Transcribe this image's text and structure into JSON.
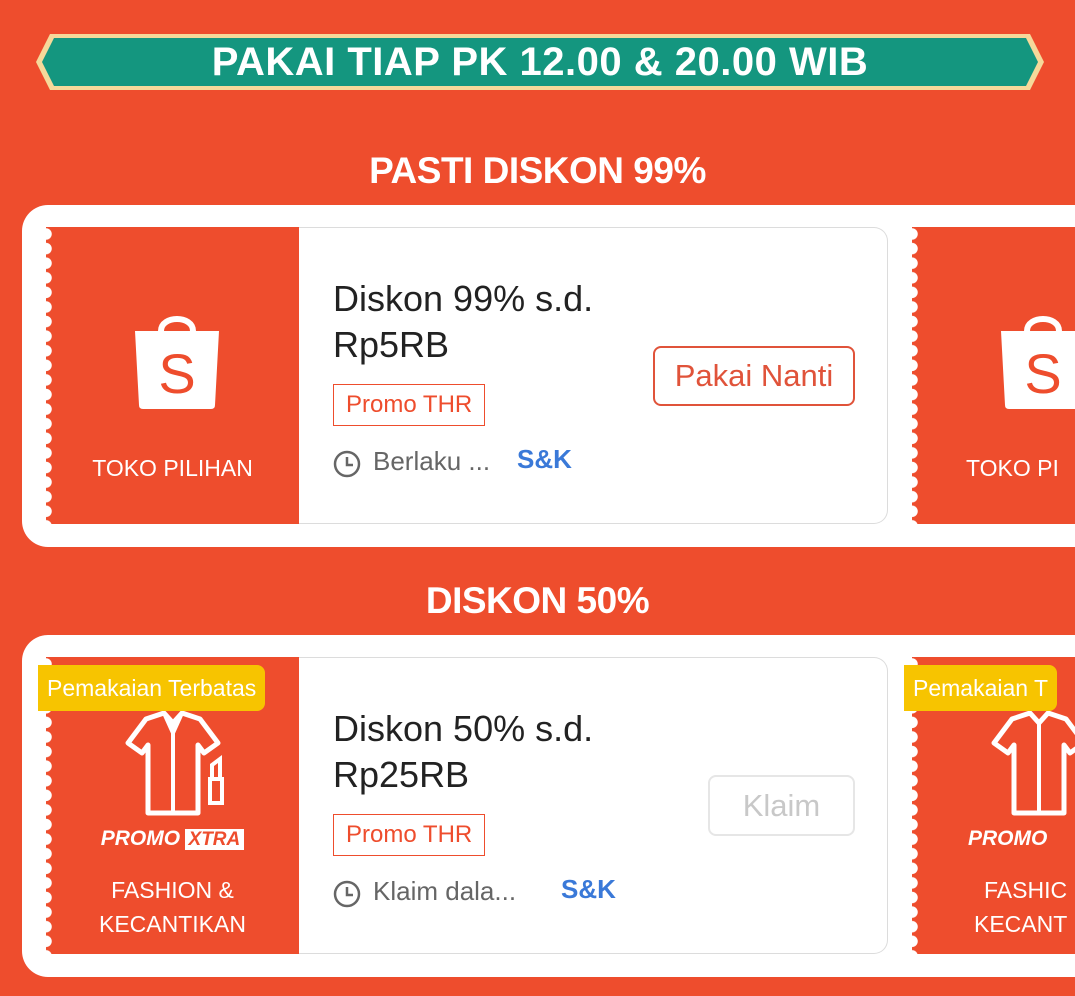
{
  "banner": {
    "text": "PAKAI TIAP PK 12.00 & 20.00 WIB",
    "bg_color": "#14967f",
    "border_color": "#f6d99a"
  },
  "sections": [
    {
      "title": "PASTI DISKON 99%",
      "voucher": {
        "category": "TOKO PILIHAN",
        "icon": "shopee-bag-icon",
        "title_line1": "Diskon 99% s.d.",
        "title_line2": "Rp5RB",
        "tag": "Promo THR",
        "validity": "Berlaku ...",
        "terms": "S&K",
        "button": "Pakai Nanti"
      },
      "next_voucher": {
        "category": "TOKO PI"
      }
    },
    {
      "title": "DISKON 50%",
      "voucher": {
        "badge": "Pemakaian Terbatas",
        "icon": "fashion-icon",
        "promo_logo_left": "PROMO",
        "promo_logo_right": "XTRA",
        "category_line1": "FASHION &",
        "category_line2": "KECANTIKAN",
        "title_line1": "Diskon 50% s.d.",
        "title_line2": "Rp25RB",
        "tag": "Promo THR",
        "validity": "Klaim dala...",
        "terms": "S&K",
        "button": "Klaim"
      },
      "next_voucher": {
        "badge": "Pemakaian T",
        "promo_logo": "PROMO",
        "category_line1": "FASHIC",
        "category_line2": "KECANT"
      }
    }
  ],
  "colors": {
    "brand": "#ee4d2d",
    "terms_link": "#3a79d8",
    "badge": "#f7c400"
  }
}
